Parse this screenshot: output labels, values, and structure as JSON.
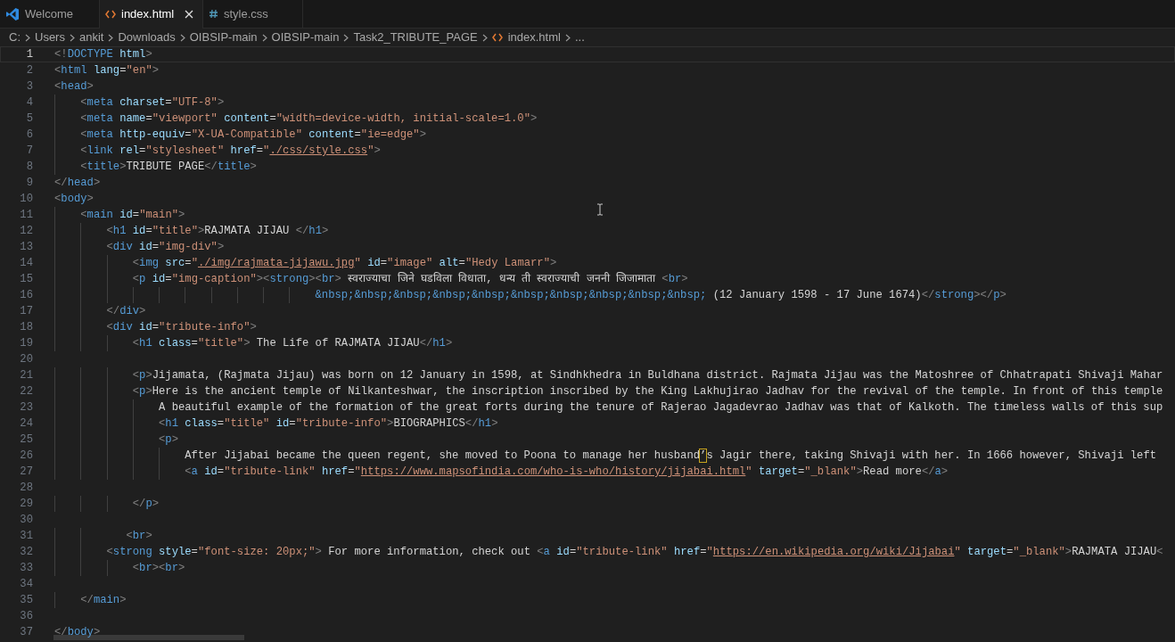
{
  "tabs": [
    {
      "label": "Welcome",
      "kind": "welcome",
      "selected": false,
      "closable": false
    },
    {
      "label": "index.html",
      "kind": "html",
      "selected": true,
      "closable": true
    },
    {
      "label": "style.css",
      "kind": "css",
      "selected": false,
      "closable": false
    }
  ],
  "breadcrumb": [
    {
      "label": "C:",
      "kind": "folder"
    },
    {
      "label": "Users",
      "kind": "folder"
    },
    {
      "label": "ankit",
      "kind": "folder"
    },
    {
      "label": "Downloads",
      "kind": "folder"
    },
    {
      "label": "OIBSIP-main",
      "kind": "folder"
    },
    {
      "label": "OIBSIP-main",
      "kind": "folder"
    },
    {
      "label": "Task2_TRIBUTE_PAGE",
      "kind": "folder"
    },
    {
      "label": "index.html",
      "kind": "html"
    },
    {
      "label": "...",
      "kind": "folder"
    }
  ],
  "lines": [
    {
      "number": "1",
      "active": true,
      "tokens": [
        {
          "kind": "punct",
          "text": "<!"
        },
        {
          "kind": "tag",
          "text": "DOCTYPE"
        },
        {
          "kind": "attr",
          "text": " html"
        },
        {
          "kind": "punct",
          "text": ">"
        }
      ]
    },
    {
      "number": "2",
      "active": false,
      "tokens": [
        {
          "kind": "punct",
          "text": "<"
        },
        {
          "kind": "tag",
          "text": "html"
        },
        {
          "kind": "attr",
          "text": " lang"
        },
        {
          "kind": "text",
          "text": "="
        },
        {
          "kind": "string",
          "text": "\"en\""
        },
        {
          "kind": "punct",
          "text": ">"
        }
      ]
    },
    {
      "number": "3",
      "active": false,
      "tokens": [
        {
          "kind": "punct",
          "text": "<"
        },
        {
          "kind": "tag",
          "text": "head"
        },
        {
          "kind": "punct",
          "text": ">"
        }
      ]
    },
    {
      "number": "4",
      "active": false,
      "tokens": [
        {
          "kind": "punct",
          "text": "    <"
        },
        {
          "kind": "tag",
          "text": "meta"
        },
        {
          "kind": "attr",
          "text": " charset"
        },
        {
          "kind": "text",
          "text": "="
        },
        {
          "kind": "string",
          "text": "\"UTF-8\""
        },
        {
          "kind": "punct",
          "text": ">"
        }
      ]
    },
    {
      "number": "5",
      "active": false,
      "tokens": [
        {
          "kind": "punct",
          "text": "    <"
        },
        {
          "kind": "tag",
          "text": "meta"
        },
        {
          "kind": "attr",
          "text": " name"
        },
        {
          "kind": "text",
          "text": "="
        },
        {
          "kind": "string",
          "text": "\"viewport\""
        },
        {
          "kind": "attr",
          "text": " content"
        },
        {
          "kind": "text",
          "text": "="
        },
        {
          "kind": "string",
          "text": "\"width=device-width, initial-scale=1.0\""
        },
        {
          "kind": "punct",
          "text": ">"
        }
      ]
    },
    {
      "number": "6",
      "active": false,
      "tokens": [
        {
          "kind": "punct",
          "text": "    <"
        },
        {
          "kind": "tag",
          "text": "meta"
        },
        {
          "kind": "attr",
          "text": " http-equiv"
        },
        {
          "kind": "text",
          "text": "="
        },
        {
          "kind": "string",
          "text": "\"X-UA-Compatible\""
        },
        {
          "kind": "attr",
          "text": " content"
        },
        {
          "kind": "text",
          "text": "="
        },
        {
          "kind": "string",
          "text": "\"ie=edge\""
        },
        {
          "kind": "punct",
          "text": ">"
        }
      ]
    },
    {
      "number": "7",
      "active": false,
      "tokens": [
        {
          "kind": "punct",
          "text": "    <"
        },
        {
          "kind": "tag",
          "text": "link"
        },
        {
          "kind": "attr",
          "text": " rel"
        },
        {
          "kind": "text",
          "text": "="
        },
        {
          "kind": "string",
          "text": "\"stylesheet\""
        },
        {
          "kind": "attr",
          "text": " href"
        },
        {
          "kind": "text",
          "text": "="
        },
        {
          "kind": "string",
          "text": "\""
        },
        {
          "kind": "link",
          "text": "./css/style.css"
        },
        {
          "kind": "string",
          "text": "\""
        },
        {
          "kind": "punct",
          "text": ">"
        }
      ]
    },
    {
      "number": "8",
      "active": false,
      "tokens": [
        {
          "kind": "punct",
          "text": "    <"
        },
        {
          "kind": "tag",
          "text": "title"
        },
        {
          "kind": "punct",
          "text": ">"
        },
        {
          "kind": "text",
          "text": "TRIBUTE PAGE"
        },
        {
          "kind": "punct",
          "text": "</"
        },
        {
          "kind": "tag",
          "text": "title"
        },
        {
          "kind": "punct",
          "text": ">"
        }
      ]
    },
    {
      "number": "9",
      "active": false,
      "tokens": [
        {
          "kind": "punct",
          "text": "</"
        },
        {
          "kind": "tag",
          "text": "head"
        },
        {
          "kind": "punct",
          "text": ">"
        }
      ]
    },
    {
      "number": "10",
      "active": false,
      "tokens": [
        {
          "kind": "punct",
          "text": "<"
        },
        {
          "kind": "tag",
          "text": "body"
        },
        {
          "kind": "punct",
          "text": ">"
        }
      ]
    },
    {
      "number": "11",
      "active": false,
      "tokens": [
        {
          "kind": "punct",
          "text": "    <"
        },
        {
          "kind": "tag",
          "text": "main"
        },
        {
          "kind": "attr",
          "text": " id"
        },
        {
          "kind": "text",
          "text": "="
        },
        {
          "kind": "string",
          "text": "\"main\""
        },
        {
          "kind": "punct",
          "text": ">"
        }
      ]
    },
    {
      "number": "12",
      "active": false,
      "tokens": [
        {
          "kind": "punct",
          "text": "        <"
        },
        {
          "kind": "tag",
          "text": "h1"
        },
        {
          "kind": "attr",
          "text": " id"
        },
        {
          "kind": "text",
          "text": "="
        },
        {
          "kind": "string",
          "text": "\"title\""
        },
        {
          "kind": "punct",
          "text": ">"
        },
        {
          "kind": "text",
          "text": "RAJMATA JIJAU "
        },
        {
          "kind": "punct",
          "text": "</"
        },
        {
          "kind": "tag",
          "text": "h1"
        },
        {
          "kind": "punct",
          "text": ">"
        }
      ]
    },
    {
      "number": "13",
      "active": false,
      "tokens": [
        {
          "kind": "punct",
          "text": "        <"
        },
        {
          "kind": "tag",
          "text": "div"
        },
        {
          "kind": "attr",
          "text": " id"
        },
        {
          "kind": "text",
          "text": "="
        },
        {
          "kind": "string",
          "text": "\"img-div\""
        },
        {
          "kind": "punct",
          "text": ">"
        }
      ]
    },
    {
      "number": "14",
      "active": false,
      "tokens": [
        {
          "kind": "punct",
          "text": "            <"
        },
        {
          "kind": "tag",
          "text": "img"
        },
        {
          "kind": "attr",
          "text": " src"
        },
        {
          "kind": "text",
          "text": "="
        },
        {
          "kind": "string",
          "text": "\""
        },
        {
          "kind": "link",
          "text": "./img/rajmata-jijawu.jpg"
        },
        {
          "kind": "string",
          "text": "\""
        },
        {
          "kind": "attr",
          "text": " id"
        },
        {
          "kind": "text",
          "text": "="
        },
        {
          "kind": "string",
          "text": "\"image\""
        },
        {
          "kind": "attr",
          "text": " alt"
        },
        {
          "kind": "text",
          "text": "="
        },
        {
          "kind": "string",
          "text": "\"Hedy Lamarr\""
        },
        {
          "kind": "punct",
          "text": ">"
        }
      ]
    },
    {
      "number": "15",
      "active": false,
      "tokens": [
        {
          "kind": "punct",
          "text": "            <"
        },
        {
          "kind": "tag",
          "text": "p"
        },
        {
          "kind": "attr",
          "text": " id"
        },
        {
          "kind": "text",
          "text": "="
        },
        {
          "kind": "string",
          "text": "\"img-caption\""
        },
        {
          "kind": "punct",
          "text": "><"
        },
        {
          "kind": "tag",
          "text": "strong"
        },
        {
          "kind": "punct",
          "text": "><"
        },
        {
          "kind": "tag",
          "text": "br"
        },
        {
          "kind": "punct",
          "text": ">"
        },
        {
          "kind": "text",
          "text": " स्वराज्याचा जिने घडविला विधाता, धन्य ती स्वराज्याची जननी जिजामाता "
        },
        {
          "kind": "punct",
          "text": "<"
        },
        {
          "kind": "tag",
          "text": "br"
        },
        {
          "kind": "punct",
          "text": ">"
        }
      ]
    },
    {
      "number": "16",
      "active": false,
      "tokens": [
        {
          "kind": "entity",
          "text": "                                        &nbsp;&nbsp;&nbsp;&nbsp;&nbsp;&nbsp;&nbsp;&nbsp;&nbsp;&nbsp;"
        },
        {
          "kind": "text",
          "text": " (12 January 1598 - 17 June 1674)"
        },
        {
          "kind": "punct",
          "text": "</"
        },
        {
          "kind": "tag",
          "text": "strong"
        },
        {
          "kind": "punct",
          "text": "></"
        },
        {
          "kind": "tag",
          "text": "p"
        },
        {
          "kind": "punct",
          "text": ">"
        }
      ]
    },
    {
      "number": "17",
      "active": false,
      "tokens": [
        {
          "kind": "punct",
          "text": "        </"
        },
        {
          "kind": "tag",
          "text": "div"
        },
        {
          "kind": "punct",
          "text": ">"
        }
      ]
    },
    {
      "number": "18",
      "active": false,
      "tokens": [
        {
          "kind": "punct",
          "text": "        <"
        },
        {
          "kind": "tag",
          "text": "div"
        },
        {
          "kind": "attr",
          "text": " id"
        },
        {
          "kind": "text",
          "text": "="
        },
        {
          "kind": "string",
          "text": "\"tribute-info\""
        },
        {
          "kind": "punct",
          "text": ">"
        }
      ]
    },
    {
      "number": "19",
      "active": false,
      "tokens": [
        {
          "kind": "punct",
          "text": "            <"
        },
        {
          "kind": "tag",
          "text": "h1"
        },
        {
          "kind": "attr",
          "text": " class"
        },
        {
          "kind": "text",
          "text": "="
        },
        {
          "kind": "string",
          "text": "\"title\""
        },
        {
          "kind": "punct",
          "text": ">"
        },
        {
          "kind": "text",
          "text": " The Life of RAJMATA JIJAU"
        },
        {
          "kind": "punct",
          "text": "</"
        },
        {
          "kind": "tag",
          "text": "h1"
        },
        {
          "kind": "punct",
          "text": ">"
        }
      ]
    },
    {
      "number": "20",
      "active": false
    },
    {
      "number": "21",
      "active": false,
      "tokens": [
        {
          "kind": "punct",
          "text": "            <"
        },
        {
          "kind": "tag",
          "text": "p"
        },
        {
          "kind": "punct",
          "text": ">"
        },
        {
          "kind": "text",
          "text": "Jijamata, (Rajmata Jijau) was born on 12 January in 1598, at Sindhkhedra in Buldhana district. Rajmata Jijau was the Matoshree of Chhatrapati Shivaji Mahar"
        }
      ]
    },
    {
      "number": "22",
      "active": false,
      "tokens": [
        {
          "kind": "punct",
          "text": "            <"
        },
        {
          "kind": "tag",
          "text": "p"
        },
        {
          "kind": "punct",
          "text": ">"
        },
        {
          "kind": "text",
          "text": "Here is the ancient temple of Nilkanteshwar, the inscription inscribed by the King Lakhujirao Jadhav for the revival of the temple. In front of this temple"
        }
      ]
    },
    {
      "number": "23",
      "active": false,
      "tokens": [
        {
          "kind": "text",
          "text": "                A beautiful example of the formation of the great forts during the tenure of Rajerao Jagadevrao Jadhav was that of Kalkoth. The timeless walls of this sup"
        }
      ]
    },
    {
      "number": "24",
      "active": false,
      "tokens": [
        {
          "kind": "punct",
          "text": "                <"
        },
        {
          "kind": "tag",
          "text": "h1"
        },
        {
          "kind": "attr",
          "text": " class"
        },
        {
          "kind": "text",
          "text": "="
        },
        {
          "kind": "string",
          "text": "\"title\""
        },
        {
          "kind": "attr",
          "text": " id"
        },
        {
          "kind": "text",
          "text": "="
        },
        {
          "kind": "string",
          "text": "\"tribute-info\""
        },
        {
          "kind": "punct",
          "text": ">"
        },
        {
          "kind": "text",
          "text": "BIOGRAPHICS"
        },
        {
          "kind": "punct",
          "text": "</"
        },
        {
          "kind": "tag",
          "text": "h1"
        },
        {
          "kind": "punct",
          "text": ">"
        }
      ]
    },
    {
      "number": "25",
      "active": false,
      "tokens": [
        {
          "kind": "punct",
          "text": "                <"
        },
        {
          "kind": "tag",
          "text": "p"
        },
        {
          "kind": "punct",
          "text": ">"
        }
      ]
    },
    {
      "number": "26",
      "active": false,
      "tokens": [
        {
          "kind": "text",
          "text": "                    After Jijabai became the queen regent, she moved to Poona to manage her husband"
        },
        {
          "kind": "flagged",
          "text": "’"
        },
        {
          "kind": "text",
          "text": "s Jagir there, taking Shivaji with her. In 1666 however, Shivaji left"
        }
      ]
    },
    {
      "number": "27",
      "active": false,
      "tokens": [
        {
          "kind": "punct",
          "text": "                    <"
        },
        {
          "kind": "tag",
          "text": "a"
        },
        {
          "kind": "attr",
          "text": " id"
        },
        {
          "kind": "text",
          "text": "="
        },
        {
          "kind": "string",
          "text": "\"tribute-link\""
        },
        {
          "kind": "attr",
          "text": " href"
        },
        {
          "kind": "text",
          "text": "="
        },
        {
          "kind": "string",
          "text": "\""
        },
        {
          "kind": "link",
          "text": "https://www.mapsofindia.com/who-is-who/history/jijabai.html"
        },
        {
          "kind": "string",
          "text": "\""
        },
        {
          "kind": "attr",
          "text": " target"
        },
        {
          "kind": "text",
          "text": "="
        },
        {
          "kind": "string",
          "text": "\"_blank\""
        },
        {
          "kind": "punct",
          "text": ">"
        },
        {
          "kind": "text",
          "text": "Read more"
        },
        {
          "kind": "punct",
          "text": "</"
        },
        {
          "kind": "tag",
          "text": "a"
        },
        {
          "kind": "punct",
          "text": ">"
        }
      ]
    },
    {
      "number": "28",
      "active": false
    },
    {
      "number": "29",
      "active": false,
      "tokens": [
        {
          "kind": "punct",
          "text": "            </"
        },
        {
          "kind": "tag",
          "text": "p"
        },
        {
          "kind": "punct",
          "text": ">"
        }
      ]
    },
    {
      "number": "30",
      "active": false
    },
    {
      "number": "31",
      "active": false,
      "tokens": [
        {
          "kind": "punct",
          "text": "           <"
        },
        {
          "kind": "tag",
          "text": "br"
        },
        {
          "kind": "punct",
          "text": ">"
        }
      ]
    },
    {
      "number": "32",
      "active": false,
      "tokens": [
        {
          "kind": "punct",
          "text": "        <"
        },
        {
          "kind": "tag",
          "text": "strong"
        },
        {
          "kind": "attr",
          "text": " style"
        },
        {
          "kind": "text",
          "text": "="
        },
        {
          "kind": "string",
          "text": "\"font-size: 20px;\""
        },
        {
          "kind": "punct",
          "text": ">"
        },
        {
          "kind": "text",
          "text": " For more information, check out "
        },
        {
          "kind": "punct",
          "text": "<"
        },
        {
          "kind": "tag",
          "text": "a"
        },
        {
          "kind": "attr",
          "text": " id"
        },
        {
          "kind": "text",
          "text": "="
        },
        {
          "kind": "string",
          "text": "\"tribute-link\""
        },
        {
          "kind": "attr",
          "text": " href"
        },
        {
          "kind": "text",
          "text": "="
        },
        {
          "kind": "string",
          "text": "\""
        },
        {
          "kind": "link",
          "text": "https://en.wikipedia.org/wiki/Jijabai"
        },
        {
          "kind": "string",
          "text": "\""
        },
        {
          "kind": "attr",
          "text": " target"
        },
        {
          "kind": "text",
          "text": "="
        },
        {
          "kind": "string",
          "text": "\"_blank\""
        },
        {
          "kind": "punct",
          "text": ">"
        },
        {
          "kind": "text",
          "text": "RAJMATA JIJAU"
        },
        {
          "kind": "punct",
          "text": "<"
        }
      ]
    },
    {
      "number": "33",
      "active": false,
      "tokens": [
        {
          "kind": "punct",
          "text": "            <"
        },
        {
          "kind": "tag",
          "text": "br"
        },
        {
          "kind": "punct",
          "text": "><"
        },
        {
          "kind": "tag",
          "text": "br"
        },
        {
          "kind": "punct",
          "text": ">"
        }
      ]
    },
    {
      "number": "34",
      "active": false
    },
    {
      "number": "35",
      "active": false,
      "tokens": [
        {
          "kind": "punct",
          "text": "    </"
        },
        {
          "kind": "tag",
          "text": "main"
        },
        {
          "kind": "punct",
          "text": ">"
        }
      ]
    },
    {
      "number": "36",
      "active": false
    },
    {
      "number": "37",
      "active": false,
      "tokens": [
        {
          "kind": "punct",
          "text": "</"
        },
        {
          "kind": "tag",
          "text": "body"
        },
        {
          "kind": "punct",
          "text": ">"
        }
      ]
    }
  ]
}
